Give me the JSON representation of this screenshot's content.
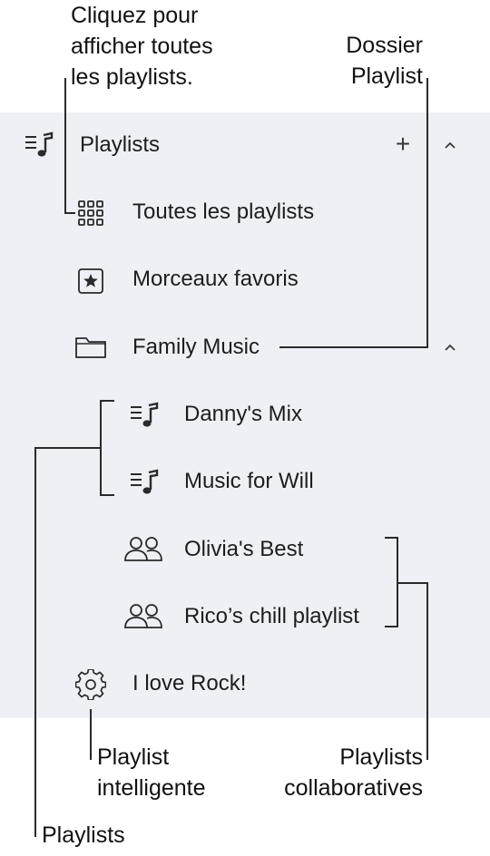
{
  "callouts": {
    "all_playlists": [
      "Cliquez pour",
      "afficher toutes",
      "les playlists."
    ],
    "folder": [
      "Dossier",
      "Playlist"
    ],
    "smart": [
      "Playlist",
      "intelligente"
    ],
    "collab": [
      "Playlists",
      "collaboratives"
    ],
    "playlists": "Playlists"
  },
  "sidebar": {
    "header": {
      "label": "Playlists",
      "add_symbol": "+",
      "collapse_symbol": "^"
    },
    "items": [
      {
        "label": "Toutes les playlists",
        "icon": "grid-icon"
      },
      {
        "label": "Morceaux favoris",
        "icon": "star-square-icon"
      },
      {
        "label": "Family Music",
        "icon": "folder-icon",
        "expanded": true
      },
      {
        "label": "Danny's Mix",
        "icon": "playlist-icon"
      },
      {
        "label": "Music for Will",
        "icon": "playlist-icon"
      },
      {
        "label": "Olivia's Best",
        "icon": "people-icon"
      },
      {
        "label": "Rico’s chill playlist",
        "icon": "people-icon"
      },
      {
        "label": "I love Rock!",
        "icon": "gear-icon"
      }
    ]
  },
  "colors": {
    "panel_bg": "#eef0f5",
    "text": "#1d1d1f",
    "line": "#2a2a2a"
  }
}
